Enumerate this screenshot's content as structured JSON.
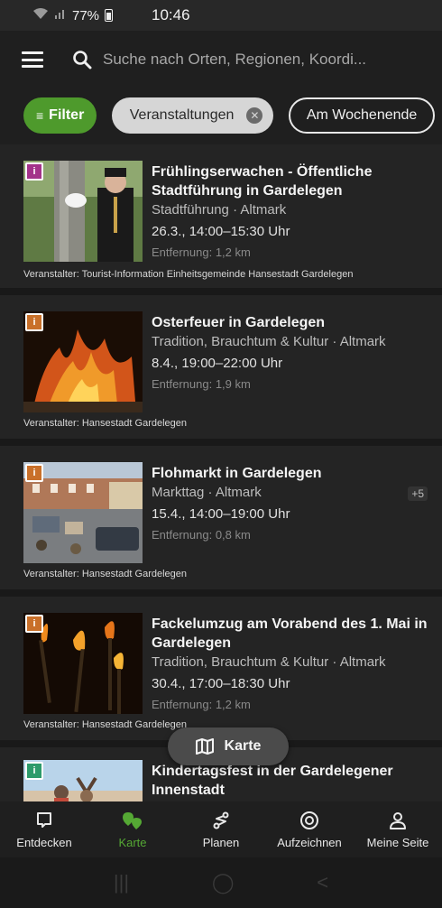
{
  "status": {
    "time": "10:46",
    "battery": "77%"
  },
  "search": {
    "placeholder": "Suche nach Orten, Regionen, Koordi..."
  },
  "filters": {
    "filter_label": "Filter",
    "chips": [
      "Veranstaltungen",
      "Am Wochenende"
    ]
  },
  "events": [
    {
      "title": "Frühlingserwachen  - Öffentliche Stadtführung in Gardelegen",
      "meta": "Stadtführung · Altmark",
      "time": "26.3., 14:00–15:30 Uhr",
      "distance": "Entfernung: 1,2 km",
      "organizer": "Veranstalter: Tourist-Information Einheitsgemeinde Hansestadt Gardelegen",
      "badge_color": "#a3338a"
    },
    {
      "title": "Osterfeuer in Gardelegen",
      "meta": "Tradition, Brauchtum & Kultur · Altmark",
      "time": "8.4., 19:00–22:00 Uhr",
      "distance": "Entfernung: 1,9 km",
      "organizer": "Veranstalter: Hansestadt Gardelegen",
      "badge_color": "#c9702a"
    },
    {
      "title": "Flohmarkt in Gardelegen",
      "meta": "Markttag · Altmark",
      "time": "15.4., 14:00–19:00 Uhr",
      "distance": "Entfernung: 0,8 km",
      "organizer": "Veranstalter: Hansestadt Gardelegen",
      "extra": "+5",
      "badge_color": "#c9702a"
    },
    {
      "title": "Fackelumzug am Vorabend des 1. Mai in Gardelegen",
      "meta": "Tradition, Brauchtum & Kultur · Altmark",
      "time": "30.4., 17:00–18:30 Uhr",
      "distance": "Entfernung: 1,2 km",
      "organizer": "Veranstalter: Hansestadt Gardelegen",
      "badge_color": "#c9702a"
    },
    {
      "title": "Kindertagsfest in der Gardelegener Innenstadt",
      "badge_color": "#2d9b6b"
    }
  ],
  "map_button": "Karte",
  "nav": [
    {
      "label": "Entdecken",
      "icon": "message-square-icon"
    },
    {
      "label": "Karte",
      "icon": "map-pins-icon"
    },
    {
      "label": "Planen",
      "icon": "route-icon"
    },
    {
      "label": "Aufzeichnen",
      "icon": "record-icon"
    },
    {
      "label": "Meine Seite",
      "icon": "user-icon"
    }
  ]
}
